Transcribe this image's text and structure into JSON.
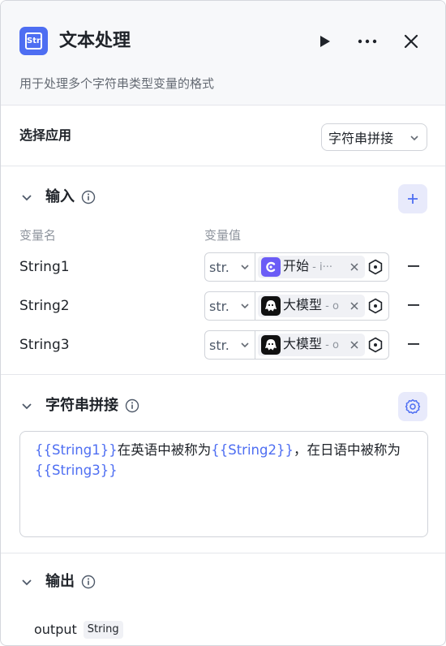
{
  "header": {
    "app_icon": "string-plugin-icon",
    "app_icon_text": "Str",
    "title": "文本处理",
    "description": "用于处理多个字符串类型变量的格式",
    "actions": [
      "play-icon",
      "more-icon",
      "close-icon"
    ]
  },
  "select_app": {
    "label": "选择应用",
    "value": "字符串拼接"
  },
  "input_section": {
    "title": "输入",
    "col_name": "变量名",
    "col_value": "变量值",
    "rows": [
      {
        "name": "String1",
        "type": "str.",
        "ref_icon": "start-node-icon",
        "ref_label": "开始",
        "ref_sub": " - i···"
      },
      {
        "name": "String2",
        "type": "str.",
        "ref_icon": "llm-node-icon",
        "ref_label": "大模型",
        "ref_sub": " - o"
      },
      {
        "name": "String3",
        "type": "str.",
        "ref_icon": "llm-node-icon",
        "ref_label": "大模型",
        "ref_sub": " - o"
      }
    ]
  },
  "concat_section": {
    "title": "字符串拼接",
    "template_parts": [
      {
        "text": "{{String1}}",
        "var": true
      },
      {
        "text": "在英语中被称为",
        "var": false
      },
      {
        "text": "{{String2}}",
        "var": true
      },
      {
        "text": "，在日语中被称为",
        "var": false
      },
      {
        "text": "{{String3}}",
        "var": true
      }
    ]
  },
  "output_section": {
    "title": "输出",
    "name": "output",
    "type": "String"
  },
  "colors": {
    "accent": "#4e6ef2",
    "header_bg": "#f7f8fa",
    "soft_button_bg": "#e8eafb"
  }
}
